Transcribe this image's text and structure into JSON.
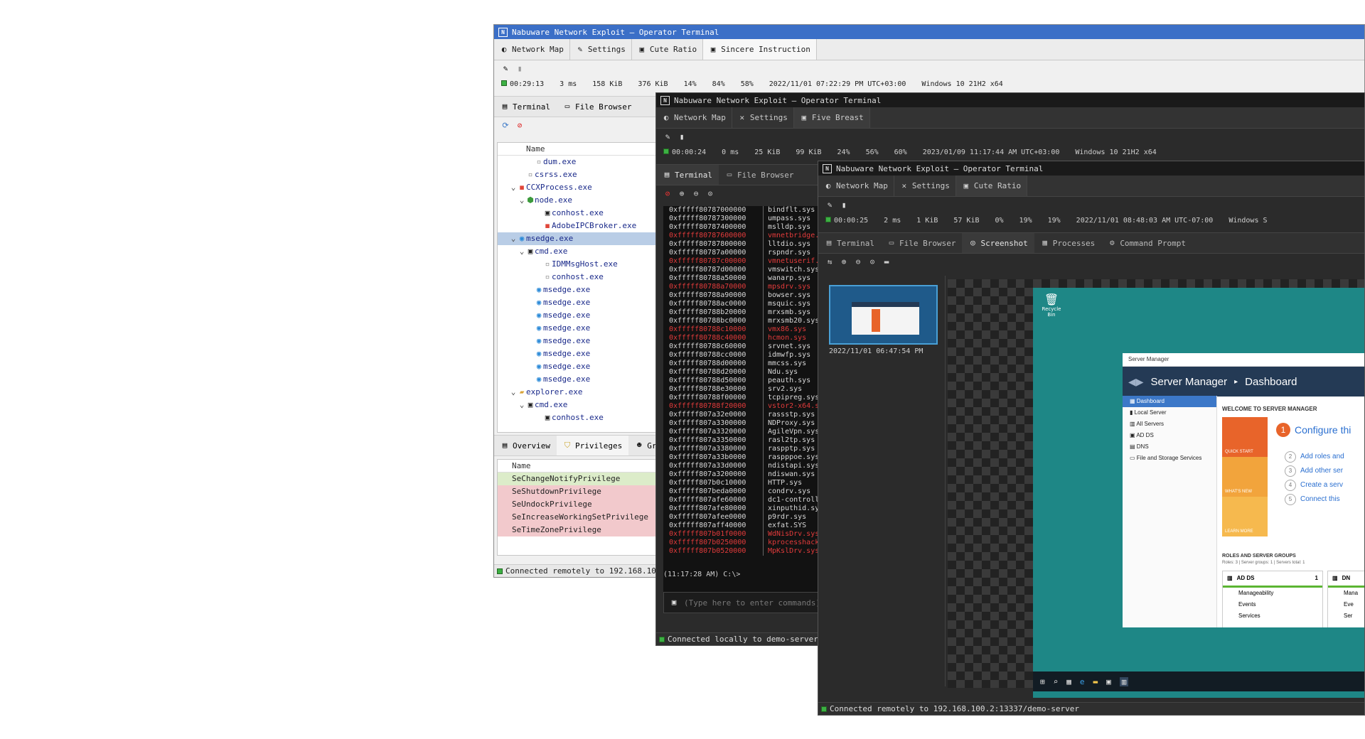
{
  "app_title": "Nabuware Network Exploit — Operator Terminal",
  "colors": {
    "accent_blue": "#3b6fc7",
    "ok_green": "#3cb043",
    "error_red": "#e23b3b",
    "desktop_teal": "#1e8786"
  },
  "w1": {
    "tabs": [
      "Network Map",
      "Settings",
      "Cute Ratio",
      "Sincere Instruction"
    ],
    "status": {
      "uptime": "00:29:13",
      "latency": "3 ms",
      "up": "158 KiB",
      "down": "376 KiB",
      "cpu": "14%",
      "mem": "84%",
      "disk": "58%",
      "time": "2022/11/01 07:22:29 PM UTC+03:00",
      "os": "Windows 10 21H2 x64"
    },
    "subtabs": [
      "Terminal",
      "File Browser"
    ],
    "tree_header": "Name",
    "tree": [
      {
        "indent": 4,
        "arrow": "",
        "name": "dum.exe",
        "icon": "file-icon"
      },
      {
        "indent": 3,
        "arrow": "",
        "name": "csrss.exe",
        "icon": "file-icon"
      },
      {
        "indent": 2,
        "arrow": "v",
        "name": "CCXProcess.exe",
        "icon": "app-icon"
      },
      {
        "indent": 3,
        "arrow": "v",
        "name": "node.exe",
        "icon": "node-icon"
      },
      {
        "indent": 5,
        "arrow": "",
        "name": "conhost.exe",
        "icon": "console-icon"
      },
      {
        "indent": 5,
        "arrow": "",
        "name": "AdobeIPCBroker.exe",
        "icon": "app-icon"
      },
      {
        "indent": 2,
        "arrow": "v",
        "name": "msedge.exe",
        "icon": "edge-icon",
        "sel": true
      },
      {
        "indent": 3,
        "arrow": "v",
        "name": "cmd.exe",
        "icon": "console-icon"
      },
      {
        "indent": 5,
        "arrow": "",
        "name": "IDMMsgHost.exe",
        "icon": "file-icon"
      },
      {
        "indent": 5,
        "arrow": "",
        "name": "conhost.exe",
        "icon": "file-icon"
      },
      {
        "indent": 4,
        "arrow": "",
        "name": "msedge.exe",
        "icon": "edge-icon"
      },
      {
        "indent": 4,
        "arrow": "",
        "name": "msedge.exe",
        "icon": "edge-icon"
      },
      {
        "indent": 4,
        "arrow": "",
        "name": "msedge.exe",
        "icon": "edge-icon"
      },
      {
        "indent": 4,
        "arrow": "",
        "name": "msedge.exe",
        "icon": "edge-icon"
      },
      {
        "indent": 4,
        "arrow": "",
        "name": "msedge.exe",
        "icon": "edge-icon"
      },
      {
        "indent": 4,
        "arrow": "",
        "name": "msedge.exe",
        "icon": "edge-icon"
      },
      {
        "indent": 4,
        "arrow": "",
        "name": "msedge.exe",
        "icon": "edge-icon"
      },
      {
        "indent": 4,
        "arrow": "",
        "name": "msedge.exe",
        "icon": "edge-icon"
      },
      {
        "indent": 2,
        "arrow": "v",
        "name": "explorer.exe",
        "icon": "folder-icon"
      },
      {
        "indent": 3,
        "arrow": "v",
        "name": "cmd.exe",
        "icon": "console-icon"
      },
      {
        "indent": 5,
        "arrow": "",
        "name": "conhost.exe",
        "icon": "console-icon"
      }
    ],
    "lower_tabs": [
      "Overview",
      "Privileges",
      "Gr"
    ],
    "priv_header": "Name",
    "privileges": [
      {
        "name": "SeChangeNotifyPrivilege",
        "state": "ok"
      },
      {
        "name": "SeShutdownPrivilege",
        "state": "bad"
      },
      {
        "name": "SeUndockPrivilege",
        "state": "bad"
      },
      {
        "name": "SeIncreaseWorkingSetPrivilege",
        "state": "bad"
      },
      {
        "name": "SeTimeZonePrivilege",
        "state": "bad"
      }
    ],
    "footer": "Connected remotely to 192.168.100.2"
  },
  "w2": {
    "tabs": [
      "Network Map",
      "Settings",
      "Five Breast"
    ],
    "status": {
      "uptime": "00:00:24",
      "latency": "0 ms",
      "up": "25 KiB",
      "down": "99 KiB",
      "cpu": "24%",
      "mem": "56%",
      "disk": "60%",
      "time": "2023/01/09 11:17:44 AM UTC+03:00",
      "os": "Windows 10 21H2 x64"
    },
    "subtabs": [
      "Terminal",
      "File Browser"
    ],
    "rows": [
      {
        "a": "0xfffff80787000000",
        "b": "bindflt.sys",
        "c": "w"
      },
      {
        "a": "0xfffff80787300000",
        "b": "umpass.sys",
        "c": "w"
      },
      {
        "a": "0xfffff80787400000",
        "b": "mslldp.sys",
        "c": "w"
      },
      {
        "a": "0xfffff80787600000",
        "b": "vmnetbridge.s",
        "c": "r"
      },
      {
        "a": "0xfffff80787800000",
        "b": "lltdio.sys",
        "c": "w"
      },
      {
        "a": "0xfffff80787a00000",
        "b": "rspndr.sys",
        "c": "w"
      },
      {
        "a": "0xfffff80787c00000",
        "b": "vmnetuserif.s",
        "c": "r"
      },
      {
        "a": "0xfffff80787d00000",
        "b": "vmswitch.sys",
        "c": "w"
      },
      {
        "a": "0xfffff80788a50000",
        "b": "wanarp.sys",
        "c": "w"
      },
      {
        "a": "0xfffff80788a70000",
        "b": "mpsdrv.sys",
        "c": "r"
      },
      {
        "a": "0xfffff80788a90000",
        "b": "bowser.sys",
        "c": "w"
      },
      {
        "a": "0xfffff80788ac0000",
        "b": "msquic.sys",
        "c": "w"
      },
      {
        "a": "0xfffff80788b20000",
        "b": "mrxsmb.sys",
        "c": "w"
      },
      {
        "a": "0xfffff80788bc0000",
        "b": "mrxsmb20.sys",
        "c": "w"
      },
      {
        "a": "0xfffff80788c10000",
        "b": "vmx86.sys",
        "c": "r"
      },
      {
        "a": "0xfffff80788c40000",
        "b": "hcmon.sys",
        "c": "r"
      },
      {
        "a": "0xfffff80788c60000",
        "b": "srvnet.sys",
        "c": "w"
      },
      {
        "a": "0xfffff80788cc0000",
        "b": "idmwfp.sys",
        "c": "w"
      },
      {
        "a": "0xfffff80788d00000",
        "b": "mmcss.sys",
        "c": "w"
      },
      {
        "a": "0xfffff80788d20000",
        "b": "Ndu.sys",
        "c": "w"
      },
      {
        "a": "0xfffff80788d50000",
        "b": "peauth.sys",
        "c": "w"
      },
      {
        "a": "0xfffff80788e30000",
        "b": "srv2.sys",
        "c": "w"
      },
      {
        "a": "0xfffff80788f00000",
        "b": "tcpipreg.sys",
        "c": "w"
      },
      {
        "a": "0xfffff80788f20000",
        "b": "vstor2-x64.s",
        "c": "r"
      },
      {
        "a": "0xfffff807a32e0000",
        "b": "rassstp.sys",
        "c": "w"
      },
      {
        "a": "0xfffff807a3300000",
        "b": "NDProxy.sys",
        "c": "w"
      },
      {
        "a": "0xfffff807a3320000",
        "b": "AgileVpn.sys",
        "c": "w"
      },
      {
        "a": "0xfffff807a3350000",
        "b": "rasl2tp.sys",
        "c": "w"
      },
      {
        "a": "0xfffff807a3380000",
        "b": "raspptp.sys",
        "c": "w"
      },
      {
        "a": "0xfffff807a33b0000",
        "b": "raspppoe.sys",
        "c": "w"
      },
      {
        "a": "0xfffff807a33d0000",
        "b": "ndistapi.sys",
        "c": "w"
      },
      {
        "a": "0xfffff807a3200000",
        "b": "ndiswan.sys",
        "c": "w"
      },
      {
        "a": "0xfffff807b0c10000",
        "b": "HTTP.sys",
        "c": "w"
      },
      {
        "a": "0xfffff807beda0000",
        "b": "condrv.sys",
        "c": "w"
      },
      {
        "a": "0xfffff807afe60000",
        "b": "dc1-controll",
        "c": "w"
      },
      {
        "a": "0xfffff807afe80000",
        "b": "xinputhid.sy",
        "c": "w"
      },
      {
        "a": "0xfffff807afee0000",
        "b": "p9rdr.sys",
        "c": "w"
      },
      {
        "a": "0xfffff807aff40000",
        "b": "exfat.SYS",
        "c": "w"
      },
      {
        "a": "0xfffff807b01f0000",
        "b": "WdNisDrv.sys",
        "c": "r"
      },
      {
        "a": "0xfffff807b0250000",
        "b": "kprocesshack",
        "c": "r"
      },
      {
        "a": "0xfffff807b0520000",
        "b": "MpKslDrv.sys",
        "c": "r"
      }
    ],
    "prompt": "(11:17:28 AM) C:\\>",
    "input_placeholder": "(Type here to enter commands)",
    "footer": "Connected locally to demo-server at"
  },
  "w3": {
    "tabs": [
      "Network Map",
      "Settings",
      "Cute Ratio"
    ],
    "status": {
      "uptime": "00:00:25",
      "latency": "2 ms",
      "up": "1 KiB",
      "down": "57 KiB",
      "cpu": "0%",
      "mem": "19%",
      "disk": "19%",
      "time": "2022/11/01 08:48:03 AM UTC-07:00",
      "os": "Windows S"
    },
    "subtabs": [
      "Terminal",
      "File Browser",
      "Screenshot",
      "Processes",
      "Command Prompt"
    ],
    "thumb_date": "2022/11/01 06:47:54 PM",
    "recycle": "Recycle Bin",
    "sm": {
      "window_title": "Server Manager",
      "heading": "Server Manager",
      "crumb": "Dashboard",
      "side": [
        "Dashboard",
        "Local Server",
        "All Servers",
        "AD DS",
        "DNS",
        "File and Storage Services"
      ],
      "welcome": "WELCOME TO SERVER MANAGER",
      "tiles": [
        "QUICK START",
        "WHAT'S NEW",
        "LEARN MORE"
      ],
      "configure": "Configure thi",
      "steps": [
        [
          "2",
          "Add roles and"
        ],
        [
          "3",
          "Add other ser"
        ],
        [
          "4",
          "Create a serv"
        ],
        [
          "5",
          "Connect this"
        ]
      ],
      "roles_title": "ROLES AND SERVER GROUPS",
      "roles_sub": "Roles: 3  |  Server groups: 1  |  Servers total: 1",
      "card1": {
        "name": "AD DS",
        "count": "1",
        "lines": [
          "Manageability",
          "Events",
          "Services"
        ]
      },
      "card2": {
        "name": "DN",
        "lines": [
          "Mana",
          "Eve",
          "Ser"
        ]
      }
    },
    "footer": "Connected remotely to 192.168.100.2:13337/demo-server"
  }
}
